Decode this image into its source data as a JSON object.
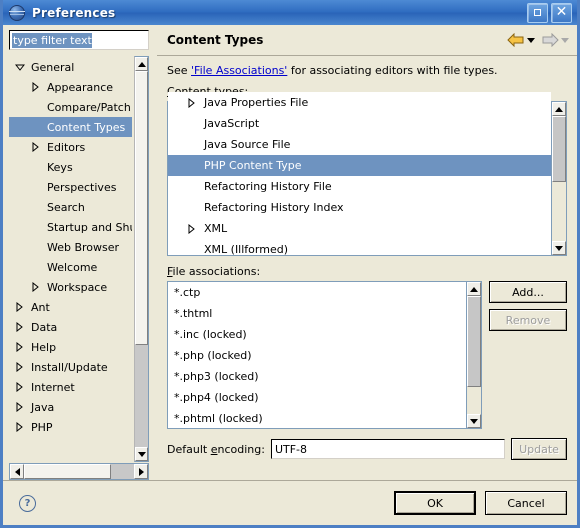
{
  "window": {
    "title": "Preferences",
    "icon": "globe-icon",
    "maximize_label": "Maximize",
    "close_label": "Close",
    "frame_color": "#4d7fc4",
    "titlebar_color": "#2f6cc0"
  },
  "filter": {
    "value": "type filter text",
    "selected": true
  },
  "tree": {
    "items": [
      {
        "label": "General",
        "indent": 0,
        "twisty": "down",
        "selected": false
      },
      {
        "label": "Appearance",
        "indent": 1,
        "twisty": "right",
        "selected": false
      },
      {
        "label": "Compare/Patch",
        "indent": 1,
        "twisty": "none",
        "selected": false
      },
      {
        "label": "Content Types",
        "indent": 1,
        "twisty": "none",
        "selected": true
      },
      {
        "label": "Editors",
        "indent": 1,
        "twisty": "right",
        "selected": false
      },
      {
        "label": "Keys",
        "indent": 1,
        "twisty": "none",
        "selected": false
      },
      {
        "label": "Perspectives",
        "indent": 1,
        "twisty": "none",
        "selected": false
      },
      {
        "label": "Search",
        "indent": 1,
        "twisty": "none",
        "selected": false
      },
      {
        "label": "Startup and Shutdo",
        "indent": 1,
        "twisty": "none",
        "selected": false
      },
      {
        "label": "Web Browser",
        "indent": 1,
        "twisty": "none",
        "selected": false
      },
      {
        "label": "Welcome",
        "indent": 1,
        "twisty": "none",
        "selected": false
      },
      {
        "label": "Workspace",
        "indent": 1,
        "twisty": "right",
        "selected": false
      },
      {
        "label": "Ant",
        "indent": 0,
        "twisty": "right",
        "selected": false
      },
      {
        "label": "Data",
        "indent": 0,
        "twisty": "right",
        "selected": false
      },
      {
        "label": "Help",
        "indent": 0,
        "twisty": "right",
        "selected": false
      },
      {
        "label": "Install/Update",
        "indent": 0,
        "twisty": "right",
        "selected": false
      },
      {
        "label": "Internet",
        "indent": 0,
        "twisty": "right",
        "selected": false
      },
      {
        "label": "Java",
        "indent": 0,
        "twisty": "right",
        "selected": false
      },
      {
        "label": "PHP",
        "indent": 0,
        "twisty": "right",
        "selected": false
      }
    ]
  },
  "page": {
    "title": "Content Types",
    "back_label": "Back",
    "forward_label": "Forward",
    "see_prefix": "See ",
    "see_link": "'File Associations'",
    "see_suffix": " for associating editors with file types.",
    "content_types_label": "Content types:",
    "file_associations_label": "File associations:",
    "content_types": [
      {
        "label": "Java Properties File",
        "twisty": "right",
        "selected": false,
        "clipped": true
      },
      {
        "label": "JavaScript",
        "twisty": "none",
        "selected": false
      },
      {
        "label": "Java Source File",
        "twisty": "none",
        "selected": false
      },
      {
        "label": "PHP Content Type",
        "twisty": "none",
        "selected": true
      },
      {
        "label": "Refactoring History File",
        "twisty": "none",
        "selected": false
      },
      {
        "label": "Refactoring History Index",
        "twisty": "none",
        "selected": false
      },
      {
        "label": "XML",
        "twisty": "right",
        "selected": false
      },
      {
        "label": "XML (Illformed)",
        "twisty": "none",
        "selected": false
      }
    ],
    "file_associations": [
      "*.ctp",
      "*.thtml",
      "*.inc (locked)",
      "*.php (locked)",
      "*.php3 (locked)",
      "*.php4 (locked)",
      "*.phtml (locked)"
    ],
    "add_label": "Add...",
    "remove_label": "Remove",
    "remove_disabled": true,
    "encoding_label": "Default encoding:",
    "encoding_value": "UTF-8",
    "update_label": "Update",
    "update_disabled": true
  },
  "footer": {
    "help_glyph": "?",
    "help_label": "Help",
    "ok_label": "OK",
    "cancel_label": "Cancel"
  },
  "colors": {
    "selection": "#6e93c0",
    "link": "#0000cc",
    "dialog_bg": "#ece9d8"
  }
}
